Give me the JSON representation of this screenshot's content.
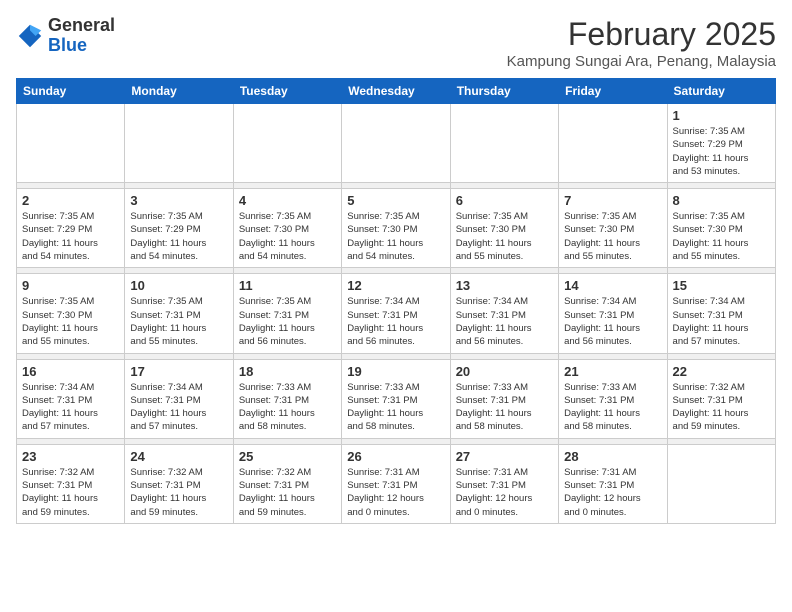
{
  "header": {
    "logo_general": "General",
    "logo_blue": "Blue",
    "month_title": "February 2025",
    "location": "Kampung Sungai Ara, Penang, Malaysia"
  },
  "weekdays": [
    "Sunday",
    "Monday",
    "Tuesday",
    "Wednesday",
    "Thursday",
    "Friday",
    "Saturday"
  ],
  "weeks": [
    [
      {
        "day": "",
        "info": ""
      },
      {
        "day": "",
        "info": ""
      },
      {
        "day": "",
        "info": ""
      },
      {
        "day": "",
        "info": ""
      },
      {
        "day": "",
        "info": ""
      },
      {
        "day": "",
        "info": ""
      },
      {
        "day": "1",
        "info": "Sunrise: 7:35 AM\nSunset: 7:29 PM\nDaylight: 11 hours\nand 53 minutes."
      }
    ],
    [
      {
        "day": "2",
        "info": "Sunrise: 7:35 AM\nSunset: 7:29 PM\nDaylight: 11 hours\nand 54 minutes."
      },
      {
        "day": "3",
        "info": "Sunrise: 7:35 AM\nSunset: 7:29 PM\nDaylight: 11 hours\nand 54 minutes."
      },
      {
        "day": "4",
        "info": "Sunrise: 7:35 AM\nSunset: 7:30 PM\nDaylight: 11 hours\nand 54 minutes."
      },
      {
        "day": "5",
        "info": "Sunrise: 7:35 AM\nSunset: 7:30 PM\nDaylight: 11 hours\nand 54 minutes."
      },
      {
        "day": "6",
        "info": "Sunrise: 7:35 AM\nSunset: 7:30 PM\nDaylight: 11 hours\nand 55 minutes."
      },
      {
        "day": "7",
        "info": "Sunrise: 7:35 AM\nSunset: 7:30 PM\nDaylight: 11 hours\nand 55 minutes."
      },
      {
        "day": "8",
        "info": "Sunrise: 7:35 AM\nSunset: 7:30 PM\nDaylight: 11 hours\nand 55 minutes."
      }
    ],
    [
      {
        "day": "9",
        "info": "Sunrise: 7:35 AM\nSunset: 7:30 PM\nDaylight: 11 hours\nand 55 minutes."
      },
      {
        "day": "10",
        "info": "Sunrise: 7:35 AM\nSunset: 7:31 PM\nDaylight: 11 hours\nand 55 minutes."
      },
      {
        "day": "11",
        "info": "Sunrise: 7:35 AM\nSunset: 7:31 PM\nDaylight: 11 hours\nand 56 minutes."
      },
      {
        "day": "12",
        "info": "Sunrise: 7:34 AM\nSunset: 7:31 PM\nDaylight: 11 hours\nand 56 minutes."
      },
      {
        "day": "13",
        "info": "Sunrise: 7:34 AM\nSunset: 7:31 PM\nDaylight: 11 hours\nand 56 minutes."
      },
      {
        "day": "14",
        "info": "Sunrise: 7:34 AM\nSunset: 7:31 PM\nDaylight: 11 hours\nand 56 minutes."
      },
      {
        "day": "15",
        "info": "Sunrise: 7:34 AM\nSunset: 7:31 PM\nDaylight: 11 hours\nand 57 minutes."
      }
    ],
    [
      {
        "day": "16",
        "info": "Sunrise: 7:34 AM\nSunset: 7:31 PM\nDaylight: 11 hours\nand 57 minutes."
      },
      {
        "day": "17",
        "info": "Sunrise: 7:34 AM\nSunset: 7:31 PM\nDaylight: 11 hours\nand 57 minutes."
      },
      {
        "day": "18",
        "info": "Sunrise: 7:33 AM\nSunset: 7:31 PM\nDaylight: 11 hours\nand 58 minutes."
      },
      {
        "day": "19",
        "info": "Sunrise: 7:33 AM\nSunset: 7:31 PM\nDaylight: 11 hours\nand 58 minutes."
      },
      {
        "day": "20",
        "info": "Sunrise: 7:33 AM\nSunset: 7:31 PM\nDaylight: 11 hours\nand 58 minutes."
      },
      {
        "day": "21",
        "info": "Sunrise: 7:33 AM\nSunset: 7:31 PM\nDaylight: 11 hours\nand 58 minutes."
      },
      {
        "day": "22",
        "info": "Sunrise: 7:32 AM\nSunset: 7:31 PM\nDaylight: 11 hours\nand 59 minutes."
      }
    ],
    [
      {
        "day": "23",
        "info": "Sunrise: 7:32 AM\nSunset: 7:31 PM\nDaylight: 11 hours\nand 59 minutes."
      },
      {
        "day": "24",
        "info": "Sunrise: 7:32 AM\nSunset: 7:31 PM\nDaylight: 11 hours\nand 59 minutes."
      },
      {
        "day": "25",
        "info": "Sunrise: 7:32 AM\nSunset: 7:31 PM\nDaylight: 11 hours\nand 59 minutes."
      },
      {
        "day": "26",
        "info": "Sunrise: 7:31 AM\nSunset: 7:31 PM\nDaylight: 12 hours\nand 0 minutes."
      },
      {
        "day": "27",
        "info": "Sunrise: 7:31 AM\nSunset: 7:31 PM\nDaylight: 12 hours\nand 0 minutes."
      },
      {
        "day": "28",
        "info": "Sunrise: 7:31 AM\nSunset: 7:31 PM\nDaylight: 12 hours\nand 0 minutes."
      },
      {
        "day": "",
        "info": ""
      }
    ]
  ]
}
